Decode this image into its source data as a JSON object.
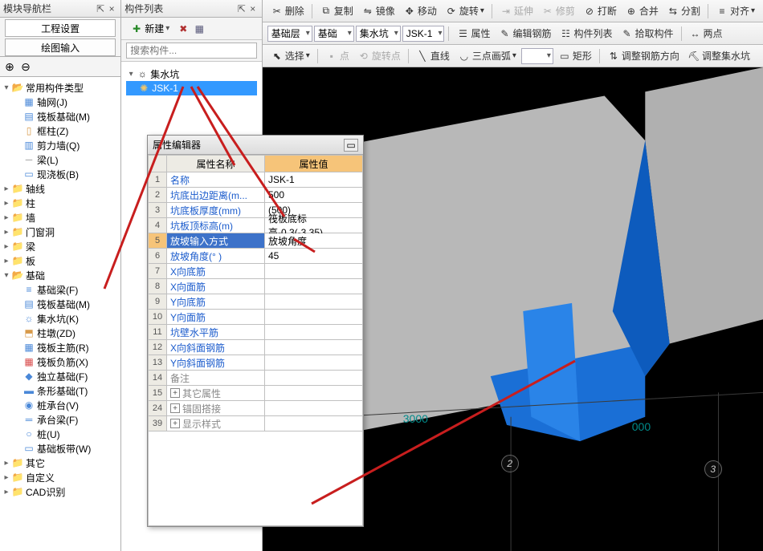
{
  "left_panel": {
    "title": "模块导航栏",
    "pin_glyph": "⇱",
    "close_glyph": "×",
    "tabs": {
      "engineering": "工程设置",
      "drawing": "绘图输入"
    },
    "toolbar": {
      "expand": "⊕",
      "collapse": "⊖"
    }
  },
  "nav": {
    "common_types": "常用构件类型",
    "axis_grid": "轴网(J)",
    "raft_foundation": "筏板基础(M)",
    "frame_column": "框柱(Z)",
    "shear_wall": "剪力墙(Q)",
    "beam": "梁(L)",
    "cast_slab": "现浇板(B)",
    "axis_lines": "轴线",
    "column": "柱",
    "wall": "墙",
    "door_window": "门窗洞",
    "beam2": "梁",
    "slab": "板",
    "foundation": "基础",
    "foundation_beam": "基础梁(F)",
    "raft_found2": "筏板基础(M)",
    "sump_pit": "集水坑(K)",
    "column_pier": "柱墩(ZD)",
    "raft_main_rebar": "筏板主筋(R)",
    "raft_neg_rebar": "筏板负筋(X)",
    "isolated_found": "独立基础(F)",
    "strip_found": "条形基础(T)",
    "pile_cap": "桩承台(V)",
    "cap_beam": "承台梁(F)",
    "pile": "桩(U)",
    "found_plate_strip": "基础板带(W)",
    "other": "其它",
    "custom": "自定义",
    "cad_recognition": "CAD识别"
  },
  "mid_panel": {
    "title": "构件列表",
    "new_btn": "新建",
    "new_icon": "✚",
    "del_icon": "✖",
    "filter_icon": "▦",
    "search_placeholder": "搜索构件...",
    "root": "集水坑",
    "item": "JSK-1"
  },
  "toolbar1": {
    "delete": "删除",
    "copy": "复制",
    "mirror": "镜像",
    "move": "移动",
    "rotate": "旋转",
    "extend": "延伸",
    "trim": "修剪",
    "break": "打断",
    "merge": "合并",
    "split": "分割",
    "align": "对齐"
  },
  "toolbar2": {
    "layer": "基础层",
    "category": "基础",
    "type": "集水坑",
    "item": "JSK-1",
    "props": "属性",
    "edit_rebar": "编辑钢筋",
    "comp_list": "构件列表",
    "pick_comp": "拾取构件",
    "two_point": "两点"
  },
  "toolbar3": {
    "select": "选择",
    "point": "点",
    "rotate_point": "旋转点",
    "line": "直线",
    "three_point_arc": "三点画弧",
    "rect": "矩形",
    "adjust_rebar_dir": "调整钢筋方向",
    "adjust_sump": "调整集水坑"
  },
  "prop": {
    "title": "属性编辑器",
    "col_name": "属性名称",
    "col_value": "属性值",
    "rows": [
      {
        "n": "1",
        "name": "名称",
        "val": "JSK-1",
        "link": true
      },
      {
        "n": "2",
        "name": "坑底出边距离(m...",
        "val": "500",
        "link": true
      },
      {
        "n": "3",
        "name": "坑底板厚度(mm)",
        "val": "(500)",
        "link": true
      },
      {
        "n": "4",
        "name": "坑板顶标高(m)",
        "val": "筏板底标高-0.3(-3.35)",
        "link": true
      },
      {
        "n": "5",
        "name": "放坡输入方式",
        "val": "放坡角度",
        "link": true,
        "hl": true
      },
      {
        "n": "6",
        "name": "放坡角度(° )",
        "val": "45",
        "link": true
      },
      {
        "n": "7",
        "name": "X向底筋",
        "val": "",
        "link": true
      },
      {
        "n": "8",
        "name": "X向面筋",
        "val": "",
        "link": true
      },
      {
        "n": "9",
        "name": "Y向底筋",
        "val": "",
        "link": true
      },
      {
        "n": "10",
        "name": "Y向面筋",
        "val": "",
        "link": true
      },
      {
        "n": "11",
        "name": "坑壁水平筋",
        "val": "",
        "link": true
      },
      {
        "n": "12",
        "name": "X向斜面钢筋",
        "val": "",
        "link": true
      },
      {
        "n": "13",
        "name": "Y向斜面钢筋",
        "val": "",
        "link": true
      },
      {
        "n": "14",
        "name": "备注",
        "val": "",
        "link": false
      },
      {
        "n": "15",
        "name": "其它属性",
        "val": "",
        "link": false,
        "expand": true
      },
      {
        "n": "24",
        "name": "锚固搭接",
        "val": "",
        "link": false,
        "expand": true
      },
      {
        "n": "39",
        "name": "显示样式",
        "val": "",
        "link": false,
        "expand": true
      }
    ]
  },
  "viewport": {
    "dim1": "3000",
    "dim2": "000",
    "axis2": "2",
    "axis3": "3"
  }
}
